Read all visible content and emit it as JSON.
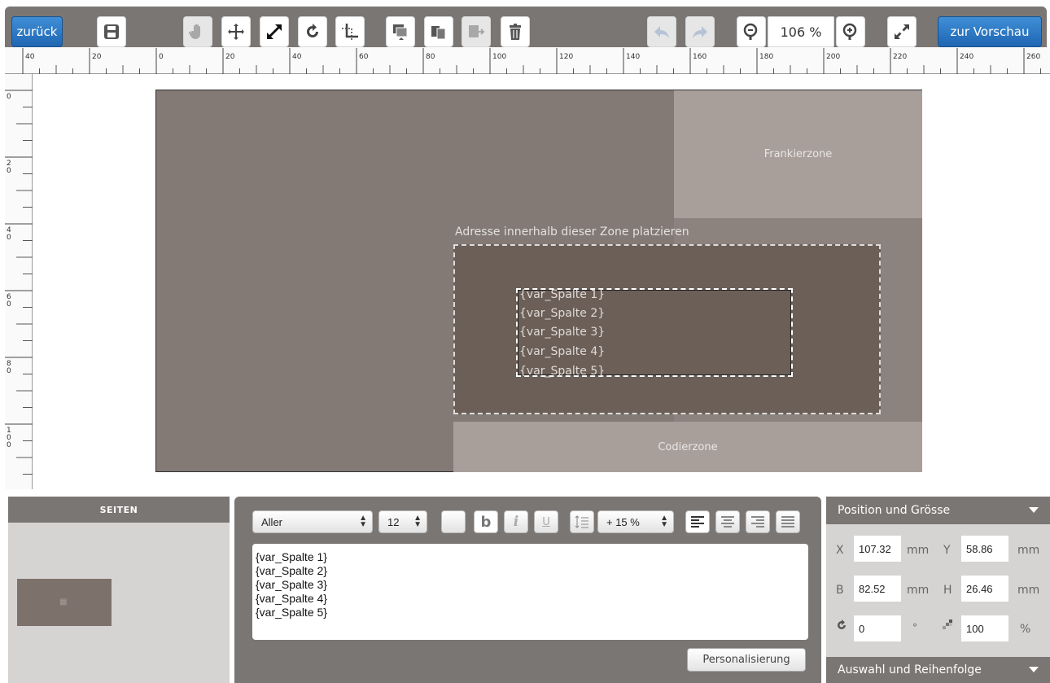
{
  "toolbar": {
    "back_label": "zurück",
    "preview_label": "zur Vorschau",
    "zoom_value": "106 %"
  },
  "ruler": {
    "horizontal_labels": [
      "40",
      "20",
      "0",
      "20",
      "40",
      "60",
      "80",
      "100",
      "120",
      "140",
      "160",
      "180",
      "200",
      "220",
      "240",
      "260"
    ],
    "vertical_labels": [
      "0",
      "20",
      "40",
      "60",
      "80",
      "100"
    ]
  },
  "canvas": {
    "frankier_label": "Frankierzone",
    "codier_label": "Codierzone",
    "address_zone_label": "Adresse innerhalb dieser Zone platzieren",
    "text_lines": [
      "{var_Spalte 1}",
      "{var_Spalte 2}",
      "{var_Spalte 3}",
      "{var_Spalte 4}",
      "{var_Spalte 5}"
    ]
  },
  "pages_panel": {
    "title": "SEITEN"
  },
  "editor": {
    "font_family": "Aller",
    "font_size": "12",
    "line_spacing": "+ 15 %",
    "lines": [
      "{var_Spalte 1}",
      "{var_Spalte 2}",
      "{var_Spalte 3}",
      "{var_Spalte 4}",
      "{var_Spalte 5}"
    ],
    "personalize_label": "Personalisierung"
  },
  "position_panel": {
    "title": "Position und Grösse",
    "x_label": "X",
    "x_value": "107.32",
    "x_unit": "mm",
    "y_label": "Y",
    "y_value": "58.86",
    "y_unit": "mm",
    "b_label": "B",
    "b_value": "82.52",
    "b_unit": "mm",
    "h_label": "H",
    "h_value": "26.46",
    "h_unit": "mm",
    "rotation_value": "0",
    "rotation_unit": "°",
    "opacity_value": "100",
    "opacity_unit": "%",
    "auswahl_title": "Auswahl und Reihenfolge"
  }
}
